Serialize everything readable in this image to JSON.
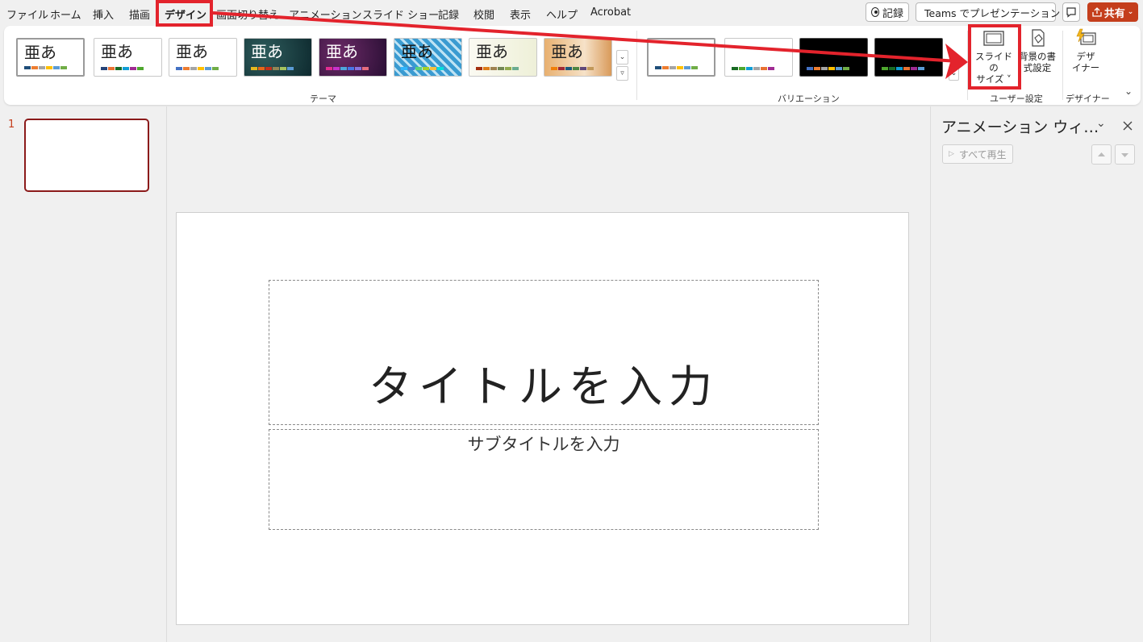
{
  "menu": {
    "tabs": [
      "ファイル",
      "ホーム",
      "挿入",
      "描画",
      "デザイン",
      "画面切り替え",
      "アニメーション",
      "スライド ショー",
      "記録",
      "校閲",
      "表示",
      "ヘルプ",
      "Acrobat"
    ],
    "active_tab": "デザイン",
    "record_button": "記録",
    "teams_button": "Teams でプレゼンテーション",
    "share_button": "共有"
  },
  "ribbon": {
    "theme_sample": "亜あ",
    "groups": {
      "themes": "テーマ",
      "variations": "バリエーション",
      "customize": "ユーザー設定",
      "designer": "デザイナー"
    },
    "slide_size_label_1": "スライドの",
    "slide_size_label_2": "サイズ ˅",
    "format_bg_label_1": "背景の書",
    "format_bg_label_2": "式設定",
    "designer_label_1": "デザ",
    "designer_label_2": "イナー"
  },
  "thumbnails": {
    "slide_number": "1"
  },
  "slide": {
    "title_placeholder": "タイトルを入力",
    "subtitle_placeholder": "サブタイトルを入力"
  },
  "animation_pane": {
    "title": "アニメーション ウィ…",
    "play_all": "すべて再生"
  },
  "colors": {
    "accent": "#c43e1c",
    "annotation_red": "#e3232c",
    "thumbnail_border": "#8b1a1a"
  }
}
